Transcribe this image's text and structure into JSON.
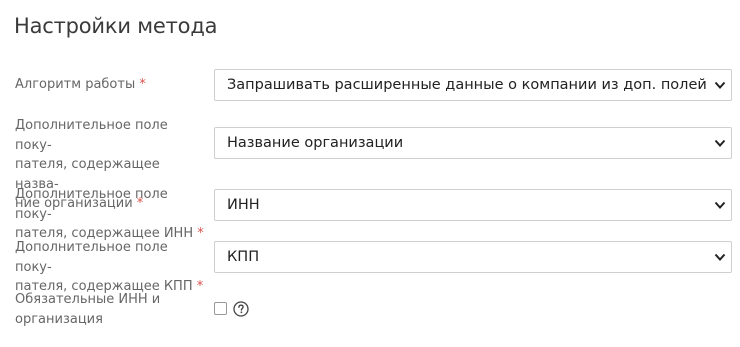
{
  "page": {
    "title": "Настройки метода"
  },
  "rows": [
    {
      "label_lines": [
        "Алгоритм работы "
      ],
      "required_mark": "*",
      "selected_value": "Запрашивать расширенные данные о компании из доп. полей"
    },
    {
      "label_lines": [
        "Дополнительное поле поку-",
        "пателя, содержащее назва-",
        "ние организации "
      ],
      "required_mark": "*",
      "selected_value": "Название организации"
    },
    {
      "label_lines": [
        "Дополнительное поле поку-",
        "пателя, содержащее ИНН "
      ],
      "required_mark": "*",
      "selected_value": "ИНН"
    },
    {
      "label_lines": [
        "Дополнительное поле поку-",
        "пателя, содержащее КПП "
      ],
      "required_mark": "*",
      "selected_value": "КПП"
    },
    {
      "label_lines": [
        "Обязательные ИНН и",
        "организация"
      ],
      "checked": false,
      "help_icon": "question-circle-icon"
    }
  ],
  "colors": {
    "required": "#d9534f",
    "label": "#666666",
    "border": "#cfcfcf"
  }
}
